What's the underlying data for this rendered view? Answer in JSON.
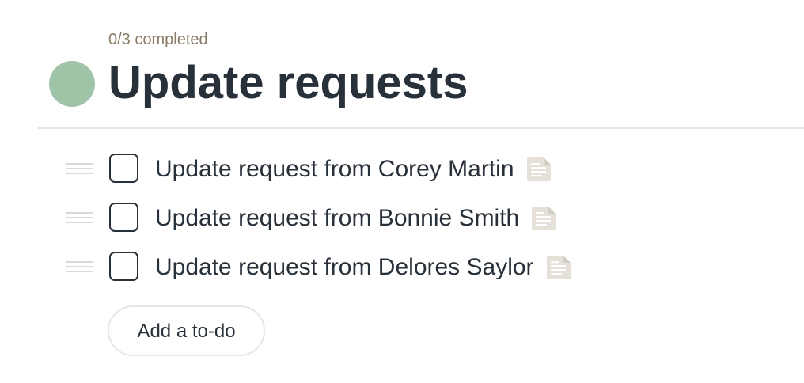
{
  "list": {
    "progress_text": "0/3 completed",
    "title": "Update requests",
    "status_color": "#9fc3a6"
  },
  "todos": [
    {
      "label": "Update request from Corey Martin",
      "completed": false,
      "has_notes": true
    },
    {
      "label": "Update request from Bonnie Smith",
      "completed": false,
      "has_notes": true
    },
    {
      "label": "Update request from Delores Saylor",
      "completed": false,
      "has_notes": true
    }
  ],
  "actions": {
    "add_todo_label": "Add a to-do"
  },
  "icons": {
    "drag_handle": "drag-handle-icon",
    "checkbox": "checkbox-icon",
    "note": "note-icon"
  },
  "colors": {
    "progress_text": "#8a7a66",
    "title_text": "#283039",
    "divider": "#e9e4da",
    "note_icon_bg": "#e6e1d8",
    "note_icon_lines": "#ffffff"
  }
}
